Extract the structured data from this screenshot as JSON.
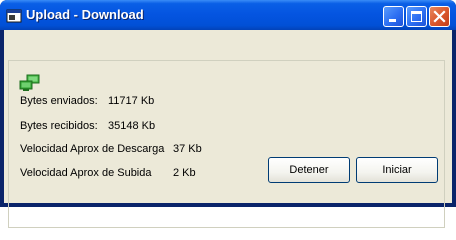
{
  "window": {
    "title": "Upload - Download",
    "controls": {
      "minimize": "minimize-icon",
      "maximize": "maximize-icon",
      "close": "close-icon"
    }
  },
  "icons": {
    "app": "app-window-icon",
    "network": "network-computers-icon"
  },
  "stats": {
    "sent_label": "Bytes enviados:",
    "sent_value": "11717 Kb",
    "received_label": "Bytes recibidos:",
    "received_value": "35148 Kb",
    "download_speed_label": "Velocidad Aprox de Descarga",
    "download_speed_value": "37 Kb",
    "upload_speed_label": "Velocidad Aprox de Subida",
    "upload_speed_value": "2 Kb"
  },
  "buttons": {
    "stop": "Detener",
    "start": "Iniciar"
  },
  "colors": {
    "titlebar": "#0454e0",
    "client_bg": "#ece9d8",
    "close_button": "#d9562b"
  }
}
